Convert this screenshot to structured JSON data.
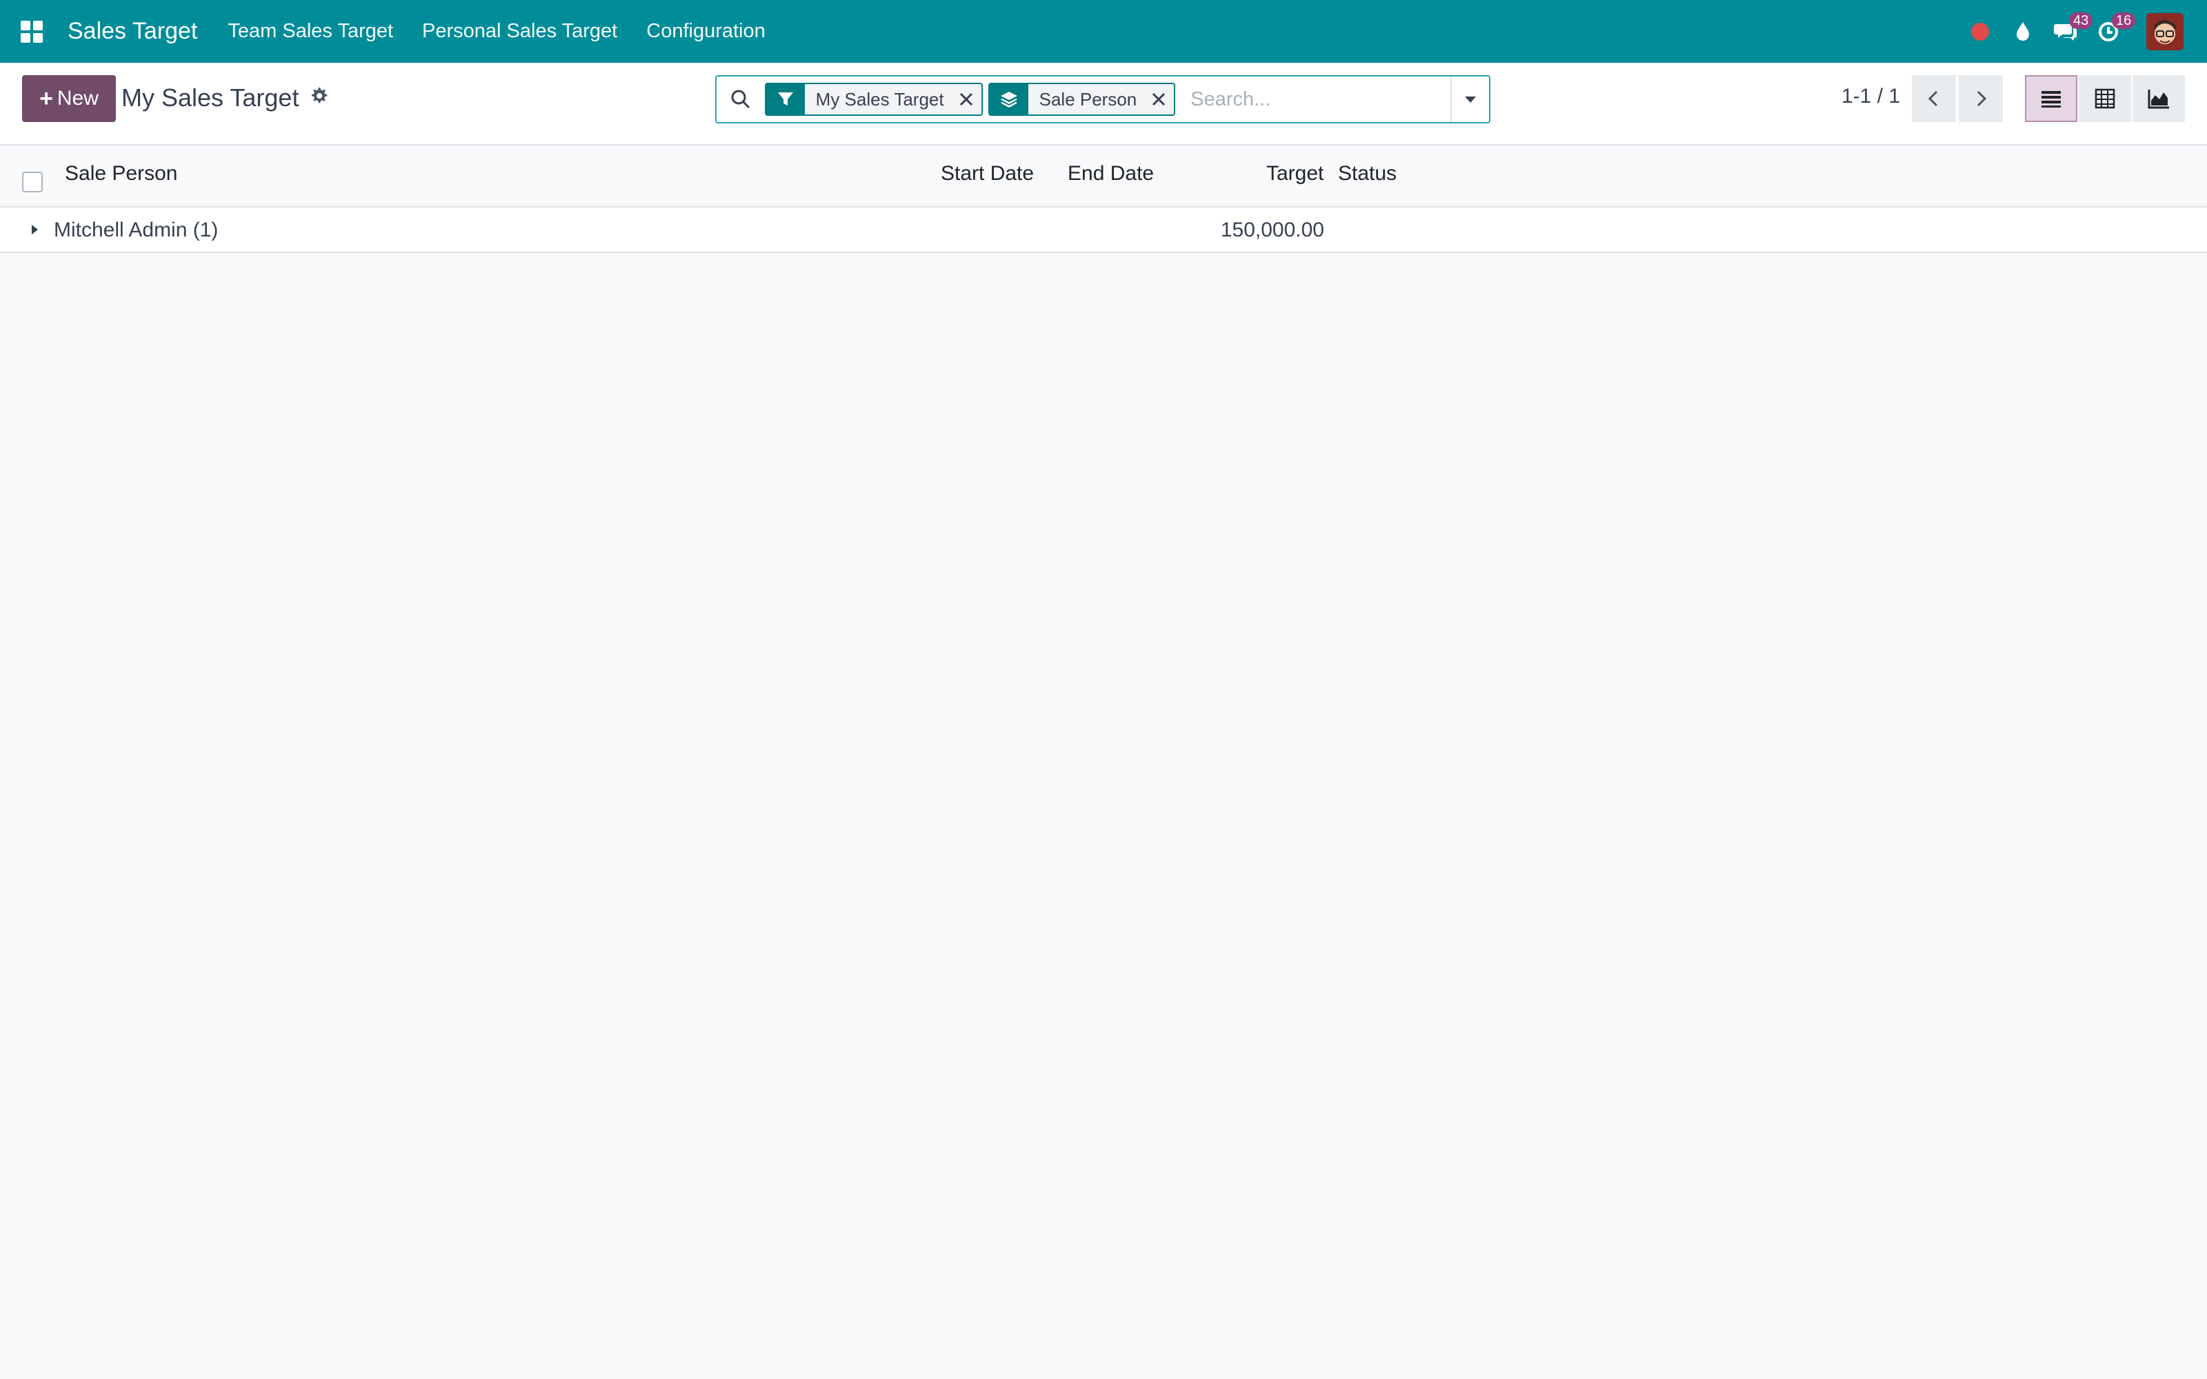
{
  "navbar": {
    "app_name": "Sales Target",
    "menu": [
      "Team Sales Target",
      "Personal Sales Target",
      "Configuration"
    ],
    "messages_count": "43",
    "activities_count": "16"
  },
  "control_panel": {
    "new_label": "New",
    "title": "My Sales Target",
    "search": {
      "facets": [
        {
          "icon": "filter-icon",
          "label": "My Sales Target"
        },
        {
          "icon": "layers-icon",
          "label": "Sale Person"
        }
      ],
      "placeholder": "Search..."
    },
    "pager": "1-1 / 1",
    "views": [
      "list-view",
      "pivot-view",
      "graph-view"
    ],
    "active_view": "list-view"
  },
  "list": {
    "columns": {
      "sale_person": "Sale Person",
      "start_date": "Start Date",
      "end_date": "End Date",
      "target": "Target",
      "status": "Status"
    },
    "groups": [
      {
        "name": "Mitchell Admin (1)",
        "target": "150,000.00"
      }
    ]
  },
  "colors": {
    "navbar": "#008c99",
    "primary_button": "#714b67",
    "facet": "#017e84",
    "badge": "#9b3c7c"
  }
}
